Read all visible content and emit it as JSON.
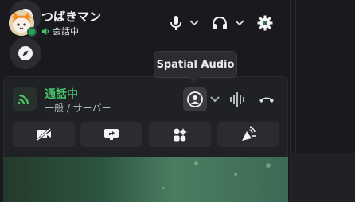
{
  "tooltip": {
    "text": "Spatial Audio"
  },
  "voice": {
    "status": "通話中",
    "channel": "一般 / サーバー"
  },
  "user": {
    "name": "つばきマン",
    "status": "会話中"
  },
  "icons": {
    "add_server": "plus-icon",
    "discover": "compass-icon",
    "voice_connection": "signal-bars-icon",
    "spatial_audio": "spatial-audio-icon",
    "soundboard": "soundwave-icon",
    "disconnect": "hang-up-icon",
    "camera_off": "camera-off-icon",
    "screen_share": "screen-share-icon",
    "activities": "activities-icon",
    "soundboard_action": "soundboard-icon",
    "mic": "microphone-icon",
    "headphones": "headphones-icon",
    "settings": "gear-icon"
  },
  "colors": {
    "connected": "#45c46a",
    "online": "#23a55a",
    "disconnect": "#f23f43"
  }
}
